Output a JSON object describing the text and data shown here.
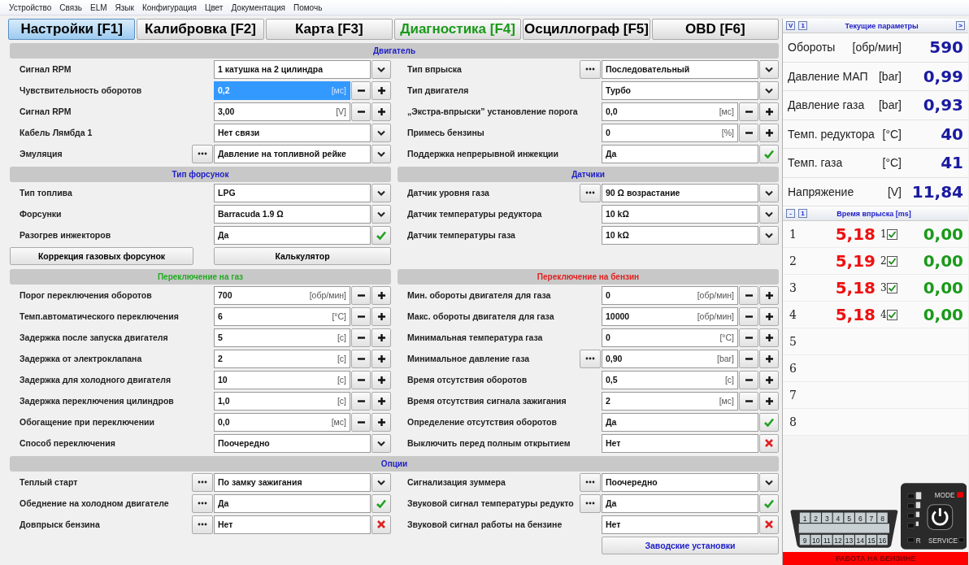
{
  "menu": [
    "Устройство",
    "Связь",
    "ELM",
    "Язык",
    "Конфигурация",
    "Цвет",
    "Документация",
    "Помочь"
  ],
  "tabs": [
    {
      "label": "Настройки [F1]",
      "selected": true,
      "color": "#000000"
    },
    {
      "label": "Калибровка [F2]",
      "selected": false,
      "color": "#000000"
    },
    {
      "label": "Карта [F3]",
      "selected": false,
      "color": "#000000"
    },
    {
      "label": "Диагностика [F4]",
      "selected": false,
      "color": "#1a9a1a"
    },
    {
      "label": "Осциллограф [F5]",
      "selected": false,
      "color": "#000000"
    },
    {
      "label": "OBD [F6]",
      "selected": false,
      "color": "#000000"
    }
  ],
  "bands": [
    {
      "title": "Двигатель",
      "color": "#1c1cc8",
      "columns": [
        {
          "rows": [
            {
              "label": "Сигнал RPM",
              "kind": "select",
              "value": "1 катушка на 2 цилиндра",
              "ellipsis": false,
              "focused": false
            },
            {
              "label": "Чувствительность оборотов",
              "kind": "spin",
              "value": "0,2",
              "unit": "[мс]",
              "ellipsis": false,
              "focused": true
            },
            {
              "label": "Сигнал RPM",
              "kind": "spin",
              "value": "3,00",
              "unit": "[V]",
              "ellipsis": false,
              "focused": false
            },
            {
              "label": "Кабель Лямбда 1",
              "kind": "select",
              "value": "Нет связи",
              "ellipsis": false,
              "focused": false
            },
            {
              "label": "Эмуляция",
              "kind": "select",
              "value": "Давление на топливной рейке",
              "ellipsis": true,
              "focused": false
            }
          ]
        },
        {
          "rows": [
            {
              "label": "Тип впрыска",
              "kind": "select",
              "value": "Последовательный",
              "ellipsis": true,
              "focused": false
            },
            {
              "label": "Тип двигателя",
              "kind": "select",
              "value": "Турбо",
              "ellipsis": false,
              "focused": false
            },
            {
              "label": "„Экстра-впрыски” установление порога",
              "kind": "spin",
              "value": "0,0",
              "unit": "[мс]",
              "ellipsis": false,
              "focused": false
            },
            {
              "label": "Примесь бензины",
              "kind": "spin",
              "value": "0",
              "unit": "[%]",
              "ellipsis": false,
              "focused": false
            },
            {
              "label": "Поддержка непрерывной инжекции",
              "kind": "toggle",
              "value": "Да",
              "on": true,
              "ellipsis": false,
              "focused": false
            }
          ]
        }
      ]
    },
    {
      "columns": [
        {
          "title": "Тип форсунок",
          "color": "#1c1cc8",
          "rows": [
            {
              "label": "Тип топлива",
              "kind": "select",
              "value": "LPG",
              "ellipsis": false,
              "focused": false
            },
            {
              "label": "Форсунки",
              "kind": "select",
              "value": "Barracuda 1.9 Ω",
              "ellipsis": false,
              "focused": false
            },
            {
              "label": "Разогрев инжекторов",
              "kind": "toggle",
              "value": "Да",
              "on": true,
              "ellipsis": false,
              "focused": false
            }
          ],
          "buttons": [
            {
              "label": "Коррекция газовых форсунок",
              "color": "#000000"
            },
            {
              "label": "Калькулятор",
              "color": "#000000"
            }
          ]
        },
        {
          "title": "Датчики",
          "color": "#1c1cc8",
          "rows": [
            {
              "label": "Датчик уровня газа",
              "kind": "select",
              "value": "90 Ω возрастание",
              "ellipsis": true,
              "focused": false
            },
            {
              "label": "Датчик температуры редуктора",
              "kind": "select",
              "value": "10 kΩ",
              "ellipsis": false,
              "focused": false
            },
            {
              "label": "Датчик температуры газа",
              "kind": "select",
              "value": "10 kΩ",
              "ellipsis": false,
              "focused": false
            }
          ]
        }
      ]
    },
    {
      "columns": [
        {
          "title": "Переключение на газ",
          "color": "#22aa22",
          "rows": [
            {
              "label": "Порог переключения оборотов",
              "kind": "spin",
              "value": "700",
              "unit": "[обр/мин]",
              "ellipsis": false,
              "focused": false
            },
            {
              "label": "Темп.автоматического переключения",
              "kind": "spin",
              "value": "6",
              "unit": "[°C]",
              "ellipsis": false,
              "focused": false
            },
            {
              "label": "Задержка после запуска двигателя",
              "kind": "spin",
              "value": "5",
              "unit": "[с]",
              "ellipsis": false,
              "focused": false
            },
            {
              "label": "Задержка от электроклапана",
              "kind": "spin",
              "value": "2",
              "unit": "[с]",
              "ellipsis": false,
              "focused": false
            },
            {
              "label": "Задержка для холодного двигателя",
              "kind": "spin",
              "value": "10",
              "unit": "[с]",
              "ellipsis": false,
              "focused": false
            },
            {
              "label": "Задержка переключения цилиндров",
              "kind": "spin",
              "value": "1,0",
              "unit": "[с]",
              "ellipsis": false,
              "focused": false
            },
            {
              "label": "Обогащение при переключении",
              "kind": "spin",
              "value": "0,0",
              "unit": "[мс]",
              "ellipsis": false,
              "focused": false
            },
            {
              "label": "Способ переключения",
              "kind": "select",
              "value": "Поочередно",
              "ellipsis": false,
              "focused": false
            }
          ]
        },
        {
          "title": "Переключение на бензин",
          "color": "#e02020",
          "rows": [
            {
              "label": "Мин. обороты двигателя для газа",
              "kind": "spin",
              "value": "0",
              "unit": "[обр/мин]",
              "ellipsis": false,
              "focused": false
            },
            {
              "label": "Макс. обороты двигателя для газа",
              "kind": "spin",
              "value": "10000",
              "unit": "[обр/мин]",
              "ellipsis": false,
              "focused": false
            },
            {
              "label": "Минимальная температура газа",
              "kind": "spin",
              "value": "0",
              "unit": "[°C]",
              "ellipsis": false,
              "focused": false
            },
            {
              "label": "Минимальное давление газа",
              "kind": "spin",
              "value": "0,90",
              "unit": "[bar]",
              "ellipsis": true,
              "focused": false
            },
            {
              "label": "Время отсутствия оборотов",
              "kind": "spin",
              "value": "0,5",
              "unit": "[с]",
              "ellipsis": false,
              "focused": false
            },
            {
              "label": "Время отсутствия сигнала зажигания",
              "kind": "spin",
              "value": "2",
              "unit": "[мс]",
              "ellipsis": false,
              "focused": false
            },
            {
              "label": "Определение отсутствия оборотов",
              "kind": "toggle",
              "value": "Да",
              "on": true,
              "ellipsis": false,
              "focused": false
            },
            {
              "label": "Выключить перед полным открытием",
              "kind": "toggle",
              "value": "Нет",
              "on": false,
              "ellipsis": false,
              "focused": false
            }
          ]
        }
      ]
    },
    {
      "title": "Опции",
      "color": "#1c1cc8",
      "columns": [
        {
          "rows": [
            {
              "label": "Теплый старт",
              "kind": "select",
              "value": "По замку зажигания",
              "ellipsis": true,
              "focused": false
            },
            {
              "label": "Обеднение на холодном двигателе",
              "kind": "toggle",
              "value": "Да",
              "on": true,
              "ellipsis": true,
              "focused": false
            },
            {
              "label": "Довпрыск бензина",
              "kind": "toggle",
              "value": "Нет",
              "on": false,
              "ellipsis": true,
              "focused": false
            }
          ]
        },
        {
          "rows": [
            {
              "label": "Сигнализация зуммера",
              "kind": "select",
              "value": "Поочередно",
              "ellipsis": true,
              "focused": false
            },
            {
              "label": "Звуковой сигнал температуры редукто",
              "kind": "toggle",
              "value": "Да",
              "on": true,
              "ellipsis": true,
              "focused": false
            },
            {
              "label": "Звуковой сигнал работы на бензине",
              "kind": "toggle",
              "value": "Нет",
              "on": false,
              "ellipsis": false,
              "focused": false
            }
          ],
          "buttons": [
            {
              "label": "Заводские установки",
              "color": "#1c1cc8"
            }
          ]
        }
      ]
    }
  ],
  "live": {
    "buttons": [
      "V",
      "1"
    ],
    "title": "Текущие параметры",
    "next_button": ">",
    "params": [
      {
        "label": "Обороты",
        "unit": "[обр/мин]",
        "value": "590"
      },
      {
        "label": "Давление МАП",
        "unit": "[bar]",
        "value": "0,99"
      },
      {
        "label": "Давление газа",
        "unit": "[bar]",
        "value": "0,93"
      },
      {
        "label": "Темп. редуктора",
        "unit": "[°C]",
        "value": "40"
      },
      {
        "label": "Темп. газа",
        "unit": "[°C]",
        "value": "41"
      },
      {
        "label": "Напряжение",
        "unit": "[V]",
        "value": "11,84"
      }
    ]
  },
  "injection": {
    "buttons": [
      "-",
      "1"
    ],
    "title": "Время впрыска [ms]",
    "rows": [
      {
        "cylinder": "1",
        "petrol": "5,18",
        "gas_cylinder": "1",
        "checked": true,
        "gas": "0,00"
      },
      {
        "cylinder": "2",
        "petrol": "5,19",
        "gas_cylinder": "2",
        "checked": true,
        "gas": "0,00"
      },
      {
        "cylinder": "3",
        "petrol": "5,18",
        "gas_cylinder": "3",
        "checked": true,
        "gas": "0,00"
      },
      {
        "cylinder": "4",
        "petrol": "5,18",
        "gas_cylinder": "4",
        "checked": true,
        "gas": "0,00"
      },
      {
        "cylinder": "5"
      },
      {
        "cylinder": "6"
      },
      {
        "cylinder": "7"
      },
      {
        "cylinder": "8"
      }
    ]
  },
  "obd_pins": [
    "1",
    "2",
    "3",
    "4",
    "5",
    "6",
    "7",
    "8",
    "9",
    "10",
    "11",
    "12",
    "13",
    "14",
    "15",
    "16"
  ],
  "switch_labels": {
    "mode": "MODE",
    "r": "R",
    "service": "SERVICE"
  },
  "status": "РАБОТА НА БЕНЗИНЕ"
}
